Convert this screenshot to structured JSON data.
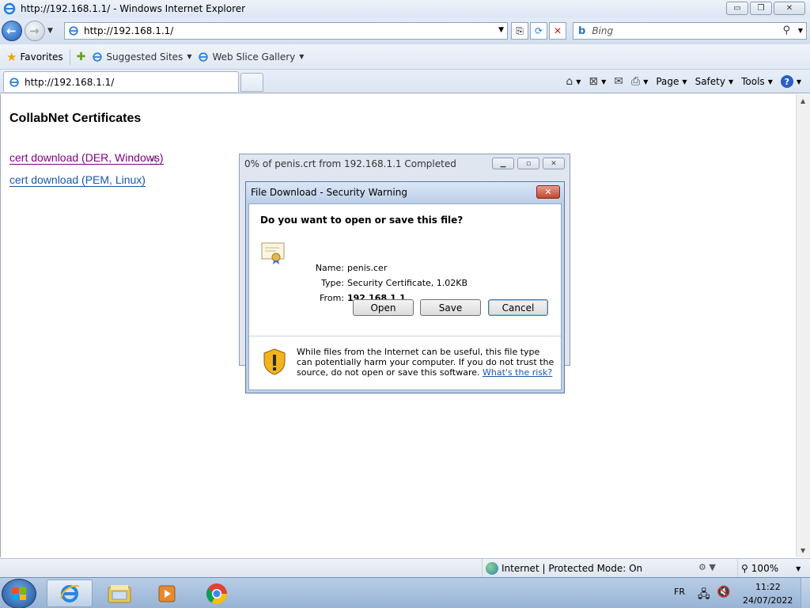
{
  "window": {
    "title": "http://192.168.1.1/ - Windows Internet Explorer",
    "minimize_glyph": "▭",
    "maximize_glyph": "❐",
    "close_glyph": "✕"
  },
  "address_bar": {
    "url": "http://192.168.1.1/",
    "search_placeholder": "Bing",
    "search_logo": "b"
  },
  "favorites_bar": {
    "favorites_label": "Favorites",
    "links": [
      {
        "label": "Suggested Sites"
      },
      {
        "label": "Web Slice Gallery"
      }
    ]
  },
  "tabs": {
    "active_label": "http://192.168.1.1/"
  },
  "command_bar": {
    "page_label": "Page",
    "safety_label": "Safety",
    "tools_label": "Tools",
    "help_glyph": "?"
  },
  "page": {
    "title": "CollabNet Certificates",
    "links": [
      {
        "label": "cert download (DER, Windows)"
      },
      {
        "label": "cert download (PEM, Linux)"
      }
    ]
  },
  "progress_dialog": {
    "title": "0% of penis.crt from 192.168.1.1 Completed"
  },
  "security_dialog": {
    "title": "File Download - Security Warning",
    "close_glyph": "✕",
    "question": "Do you want to open or save this file?",
    "name_label": "Name:",
    "name_value": "penis.cer",
    "type_label": "Type:",
    "type_value": "Security Certificate, 1.02KB",
    "from_label": "From:",
    "from_value": "192.168.1.1",
    "open_label": "Open",
    "save_label": "Save",
    "cancel_label": "Cancel",
    "warning_text": "While files from the Internet can be useful, this file type can potentially harm your computer. If you do not trust the source, do not open or save this software.",
    "risk_link": "What's the risk?"
  },
  "status_bar": {
    "zone": "Internet | Protected Mode: On",
    "zoom": "100%"
  },
  "taskbar": {
    "language": "FR",
    "time": "11:22",
    "date": "24/07/2022"
  }
}
